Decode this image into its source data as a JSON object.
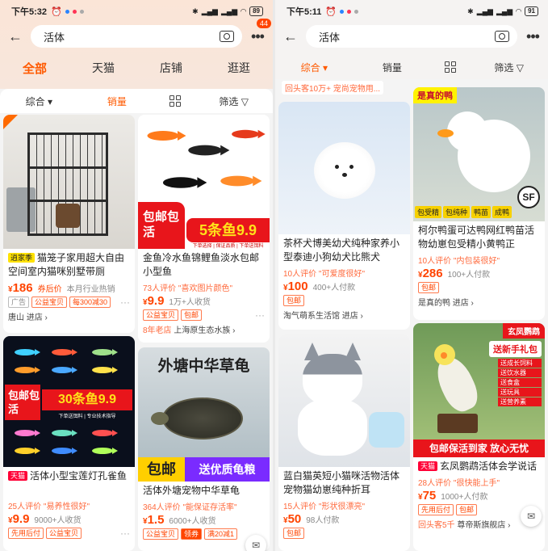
{
  "left": {
    "status": {
      "time": "下午5:32",
      "battery": "89"
    },
    "search": {
      "query": "活体",
      "badge": "44"
    },
    "categories": [
      "全部",
      "天猫",
      "店铺",
      "逛逛"
    ],
    "sort": {
      "comprehensive": "综合",
      "sales": "销量",
      "filter": "筛选"
    },
    "products": [
      {
        "tag": "逍家季",
        "title": "猫笼子家用超大自由空间室内猫咪别墅带厕",
        "price": "186",
        "price_label": "券后价",
        "sold": "本月行业热销",
        "chips": [
          "广告",
          "公益宝贝",
          "每300减30"
        ],
        "store": "唐山",
        "store_link": "进店"
      },
      {
        "title": "金鱼冷水鱼锦鲤鱼淡水包邮小型鱼",
        "review": "73人评价 \"喜欢图片颜色\"",
        "price": "9.9",
        "sold": "1万+人收货",
        "chips": [
          "公益宝贝",
          "包邮"
        ],
        "store": "上海原生态水族",
        "store_prefix": "8年老店",
        "banner_left": "包邮包活",
        "banner_right": "5条鱼9.9",
        "banner_sub": "下单选择 | 保证品质 | 下单送饵料"
      },
      {
        "tag": "天猫",
        "title": "活体小型宝莲灯孔雀鱼",
        "review": "25人评价 \"易养性很好\"",
        "price": "9.9",
        "sold": "9000+人收货",
        "chips": [
          "先用后付",
          "公益宝贝"
        ],
        "banner_left": "包邮包活",
        "banner_right": "30条鱼9.9",
        "banner_sub": "下单送饵料 | 专业技术指导"
      },
      {
        "title": "活体外塘宠物中华草龟",
        "review": "364人评价 \"能保证存活率\"",
        "price": "1.5",
        "sold": "6000+人收货",
        "chips": [
          "公益宝贝",
          "领券",
          "满20减1"
        ],
        "banner_top": "外塘中华草龟",
        "banner_left": "包邮",
        "banner_right": "送优质龟粮"
      }
    ]
  },
  "right": {
    "status": {
      "time": "下午5:11",
      "battery": "91"
    },
    "search": {
      "query": "活体"
    },
    "sort": {
      "comprehensive": "综合",
      "sales": "销量",
      "filter": "筛选"
    },
    "hint": "回头客10万+ 宠尚宠物用...",
    "products": [
      {
        "title": "茶杯犬博美幼犬纯种家养小型泰迪小狗幼犬比熊犬",
        "review": "10人评价 \"可爱度很好\"",
        "price": "100",
        "sold": "400+人付款",
        "chips": [
          "包邮"
        ],
        "store": "淘气萌系生活馆",
        "store_link": "进店"
      },
      {
        "title": "柯尔鸭蛋可达鸭网红鸭苗活物幼崽包受精小黄鸭正",
        "review": "10人评价 \"内包装很好\"",
        "price": "286",
        "sold": "100+人付款",
        "chips": [
          "包邮"
        ],
        "store": "是真的鸭",
        "store_link": "进店",
        "img_label": "是真的鸭",
        "img_chips": [
          "包受精",
          "包纯种",
          "鸭苗",
          "成鸭"
        ],
        "img_logo": "SF"
      },
      {
        "title": "蓝白猫英短小猫咪活物活体宠物猫幼崽纯种折耳",
        "review": "15人评价 \"形状很漂亮\"",
        "price": "50",
        "sold": "98人付款",
        "chips": [
          "包邮"
        ]
      },
      {
        "tag": "天猫",
        "title": "玄凤鹦鹉活体会学说话",
        "review": "28人评价 \"很快能上手\"",
        "price": "75",
        "sold": "1000+人付款",
        "chips": [
          "先用后付",
          "包邮"
        ],
        "store": "尊帝斯旗舰店",
        "store_prefix": "回头客5千",
        "img_top": "玄凤鹦鹉",
        "img_gift": "送新手礼包",
        "img_bottom": "包邮保活到家 放心无忧",
        "img_list": [
          "送成长饲料",
          "送饮水器",
          "送食盒",
          "送玩具",
          "送营养素"
        ]
      }
    ]
  },
  "colors": {
    "accent": "#ff5a00",
    "price": "#ff4400",
    "tmall": "#ff0036"
  }
}
